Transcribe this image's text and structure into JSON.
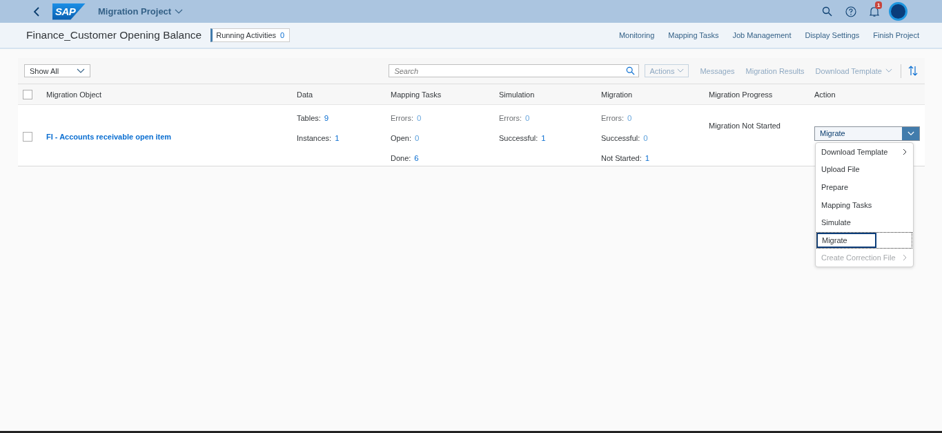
{
  "shell": {
    "logo": "SAP",
    "title": "Migration Project",
    "notification_count": "1"
  },
  "header": {
    "title": "Finance_Customer Opening Balance",
    "running_activities": {
      "label": "Running Activities",
      "count": "0"
    },
    "links": [
      "Monitoring",
      "Mapping Tasks",
      "Job Management",
      "Display Settings",
      "Finish Project"
    ]
  },
  "toolbar": {
    "filter": "Show All",
    "search": {
      "placeholder": "Search"
    },
    "actions": {
      "label": "Actions",
      "disabled": true
    },
    "links": [
      {
        "label": "Messages",
        "disabled": true,
        "dropdown": false
      },
      {
        "label": "Migration Results",
        "disabled": true,
        "dropdown": false
      },
      {
        "label": "Download Template",
        "disabled": true,
        "dropdown": true
      }
    ]
  },
  "table": {
    "all_selected": false,
    "columns": [
      "Migration Object",
      "Data",
      "Mapping Tasks",
      "Simulation",
      "Migration",
      "Migration Progress",
      "Action"
    ],
    "rows": [
      {
        "selected": false,
        "object": "FI - Accounts receivable open item",
        "data": [
          {
            "kind": "count",
            "label": "Tables:",
            "value": "9"
          },
          {
            "kind": "count",
            "label": "Instances:",
            "value": "1"
          }
        ],
        "mapping_tasks": [
          {
            "kind": "error",
            "label": "Errors:",
            "value": "0"
          },
          {
            "kind": "open",
            "label": "Open:",
            "value": "0"
          },
          {
            "kind": "count",
            "label": "Done:",
            "value": "6"
          }
        ],
        "simulation": [
          {
            "kind": "error",
            "label": "Errors:",
            "value": "0"
          },
          {
            "kind": "count",
            "label": "Successful:",
            "value": "1"
          }
        ],
        "migration": [
          {
            "kind": "error",
            "label": "Errors:",
            "value": "0"
          },
          {
            "kind": "open",
            "label": "Successful:",
            "value": "0"
          },
          {
            "kind": "count",
            "label": "Not Started:",
            "value": "1"
          }
        ],
        "progress": "Migration Not Started",
        "action": "Migrate"
      }
    ]
  },
  "menu": [
    {
      "label": "Download Template",
      "submenu": true,
      "disabled": false,
      "selected": false
    },
    {
      "label": "Upload File",
      "submenu": false,
      "disabled": false,
      "selected": false
    },
    {
      "label": "Prepare",
      "submenu": false,
      "disabled": false,
      "selected": false
    },
    {
      "label": "Mapping Tasks",
      "submenu": false,
      "disabled": false,
      "selected": false
    },
    {
      "label": "Simulate",
      "submenu": false,
      "disabled": false,
      "selected": false
    },
    {
      "label": "Migrate",
      "submenu": false,
      "disabled": false,
      "selected": true
    },
    {
      "label": "Create Correction File",
      "submenu": true,
      "disabled": true,
      "selected": false
    }
  ]
}
